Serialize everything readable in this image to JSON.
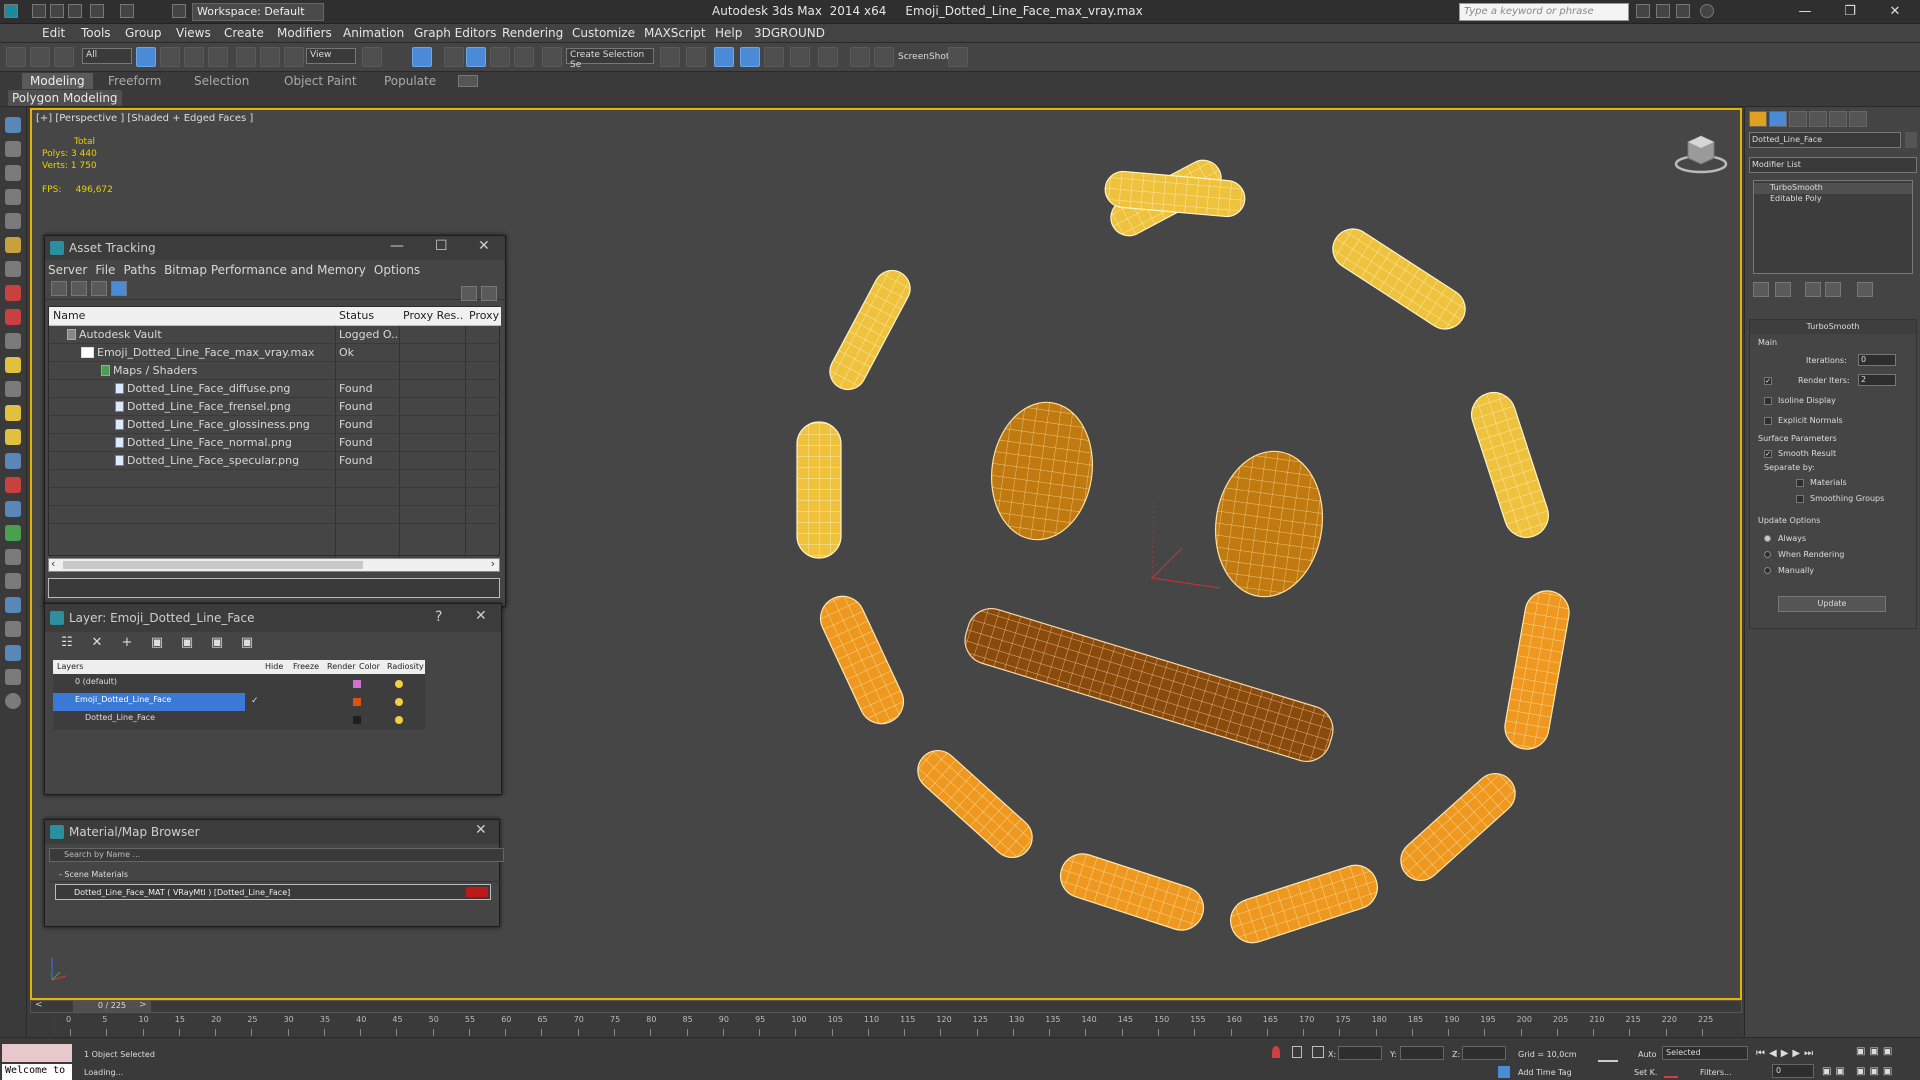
{
  "app": {
    "workspace": "Workspace: Default",
    "title": "Autodesk 3ds Max  2014 x64     Emoji_Dotted_Line_Face_max_vray.max",
    "search_placeholder": "Type a keyword or phrase"
  },
  "menu": [
    "Edit",
    "Tools",
    "Group",
    "Views",
    "Create",
    "Modifiers",
    "Animation",
    "Graph Editors",
    "Rendering",
    "Customize",
    "MAXScript",
    "Help",
    "3DGROUND"
  ],
  "toolbar": {
    "filter": "All",
    "refcoord": "View",
    "named_selection": "Create Selection Se",
    "screenshot": "ScreenShot"
  },
  "ribbon": {
    "tabs": [
      "Modeling",
      "Freeform",
      "Selection",
      "Object Paint",
      "Populate"
    ],
    "panel": "Polygon Modeling"
  },
  "viewport": {
    "label": "[+] [Perspective ] [Shaded + Edged Faces ]",
    "stats_header": "Total",
    "polys_label": "Polys:",
    "polys": "3 440",
    "verts_label": "Verts:",
    "verts": "1 750",
    "fps_label": "FPS:",
    "fps": "496,672",
    "colors": {
      "dash_yellow": "#f0c040",
      "dash_orange": "#f09a20",
      "eye": "#c07a10",
      "mouth": "#8a4a0c",
      "wire": "#fff4c8"
    }
  },
  "asset_tracking": {
    "title": "Asset Tracking",
    "menu": [
      "Server",
      "File",
      "Paths",
      "Bitmap Performance and Memory",
      "Options"
    ],
    "columns": [
      "Name",
      "Status",
      "Proxy Res...",
      "Proxy S"
    ],
    "rows": [
      {
        "name": "Autodesk Vault",
        "status": "Logged O..."
      },
      {
        "name": "Emoji_Dotted_Line_Face_max_vray.max",
        "status": "Ok"
      },
      {
        "name": "Maps / Shaders",
        "status": ""
      },
      {
        "name": "Dotted_Line_Face_diffuse.png",
        "status": "Found"
      },
      {
        "name": "Dotted_Line_Face_frensel.png",
        "status": "Found"
      },
      {
        "name": "Dotted_Line_Face_glossiness.png",
        "status": "Found"
      },
      {
        "name": "Dotted_Line_Face_normal.png",
        "status": "Found"
      },
      {
        "name": "Dotted_Line_Face_specular.png",
        "status": "Found"
      }
    ]
  },
  "layer": {
    "title": "Layer: Emoji_Dotted_Line_Face",
    "help": "?",
    "columns": [
      "Layers",
      "Hide",
      "Freeze",
      "Render",
      "Color",
      "Radiosity"
    ],
    "rows": [
      {
        "name": "0 (default)",
        "color": "#d070d0"
      },
      {
        "name": "Emoji_Dotted_Line_Face",
        "color": "#e05010"
      },
      {
        "name": "Dotted_Line_Face",
        "color": "#202020"
      }
    ]
  },
  "material_browser": {
    "title": "Material/Map Browser",
    "search_placeholder": "Search by Name ...",
    "section": "- Scene Materials",
    "item": "Dotted_Line_Face_MAT ( VRayMtl ) [Dotted_Line_Face]"
  },
  "command_panel": {
    "object_name": "Dotted_Line_Face",
    "modifier_list": "Modifier List",
    "stack": [
      "TurboSmooth",
      "Editable Poly"
    ],
    "turbosmooth": {
      "title": "TurboSmooth",
      "main": "Main",
      "iterations_label": "Iterations:",
      "iterations": "0",
      "render_iters_label": "Render Iters:",
      "render_iters": "2",
      "isoline": "Isoline Display",
      "explicit": "Explicit Normals",
      "surface": "Surface Parameters",
      "smooth_result": "Smooth Result",
      "separate_by": "Separate by:",
      "materials": "Materials",
      "smoothing_groups": "Smoothing Groups",
      "update_options": "Update Options",
      "always": "Always",
      "when_rendering": "When Rendering",
      "manually": "Manually",
      "update": "Update"
    }
  },
  "timeline": {
    "frame": "0 / 225",
    "ticks": [
      "0",
      "5",
      "10",
      "15",
      "20",
      "25",
      "30",
      "35",
      "40",
      "45",
      "50",
      "55",
      "60",
      "65",
      "70",
      "75",
      "80",
      "85",
      "90",
      "95",
      "100",
      "105",
      "110",
      "115",
      "120",
      "125",
      "130",
      "135",
      "140",
      "145",
      "150",
      "155",
      "160",
      "165",
      "170",
      "175",
      "180",
      "185",
      "190",
      "195",
      "200",
      "205",
      "210",
      "215",
      "220",
      "225"
    ]
  },
  "status": {
    "welcome": "Welcome to",
    "selected": "1 Object Selected",
    "loading": "Loading...",
    "x_label": "X:",
    "y_label": "Y:",
    "z_label": "Z:",
    "grid": "Grid = 10,0cm",
    "add_time_tag": "Add Time Tag",
    "auto": "Auto",
    "set_key": "Set K.",
    "selected_mode": "Selected",
    "filters": "Filters...",
    "frame_field": "0"
  }
}
